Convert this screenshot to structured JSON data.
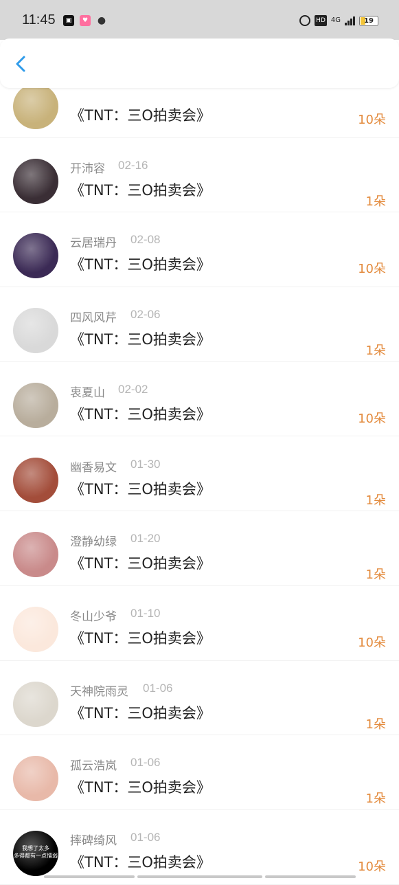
{
  "status_bar": {
    "time": "11:45",
    "battery": "19",
    "network": "4G",
    "hd": "HD",
    "icons": [
      "notification-app-icon",
      "soul-app-icon",
      "wechat-icon",
      "alarm-icon",
      "hd-icon",
      "signal-icon",
      "battery-icon"
    ]
  },
  "nav": {
    "back_icon": "chevron-left-icon"
  },
  "colors": {
    "accent": "#2f9bea",
    "amount": "#e38a3c",
    "name": "#8a8a8a",
    "date": "#b5b5b5"
  },
  "items": [
    {
      "name": "",
      "date": "",
      "title": "《TNT：三O拍卖会》",
      "amount": "10朵",
      "avatar": "#c8b27a"
    },
    {
      "name": "开沛容",
      "date": "02-16",
      "title": "《TNT：三O拍卖会》",
      "amount": "1朵",
      "avatar": "#3a2e35"
    },
    {
      "name": "云居瑞丹",
      "date": "02-08",
      "title": "《TNT：三O拍卖会》",
      "amount": "10朵",
      "avatar": "#3b2a55"
    },
    {
      "name": "四风风芹",
      "date": "02-06",
      "title": "《TNT：三O拍卖会》",
      "amount": "1朵",
      "avatar": "#d9d9d9"
    },
    {
      "name": "衷夏山",
      "date": "02-02",
      "title": "《TNT：三O拍卖会》",
      "amount": "10朵",
      "avatar": "#b8ad9c"
    },
    {
      "name": "幽香易文",
      "date": "01-30",
      "title": "《TNT：三O拍卖会》",
      "amount": "1朵",
      "avatar": "#a34d3a"
    },
    {
      "name": "澄静幼绿",
      "date": "01-20",
      "title": "《TNT：三O拍卖会》",
      "amount": "1朵",
      "avatar": "#c98a8a"
    },
    {
      "name": "冬山少爷",
      "date": "01-10",
      "title": "《TNT：三O拍卖会》",
      "amount": "10朵",
      "avatar": "#fbe8dc"
    },
    {
      "name": "天神院雨灵",
      "date": "01-06",
      "title": "《TNT：三O拍卖会》",
      "amount": "1朵",
      "avatar": "#dcd7cd"
    },
    {
      "name": "孤云浩岚",
      "date": "01-06",
      "title": "《TNT：三O拍卖会》",
      "amount": "1朵",
      "avatar": "#e8b9a9"
    },
    {
      "name": "摔碑绮风",
      "date": "01-06",
      "title": "《TNT：三O拍卖会》",
      "amount": "10朵",
      "avatar": "#000000",
      "avatar_text": "我想了太多\n多得都有一点懦弱"
    }
  ]
}
